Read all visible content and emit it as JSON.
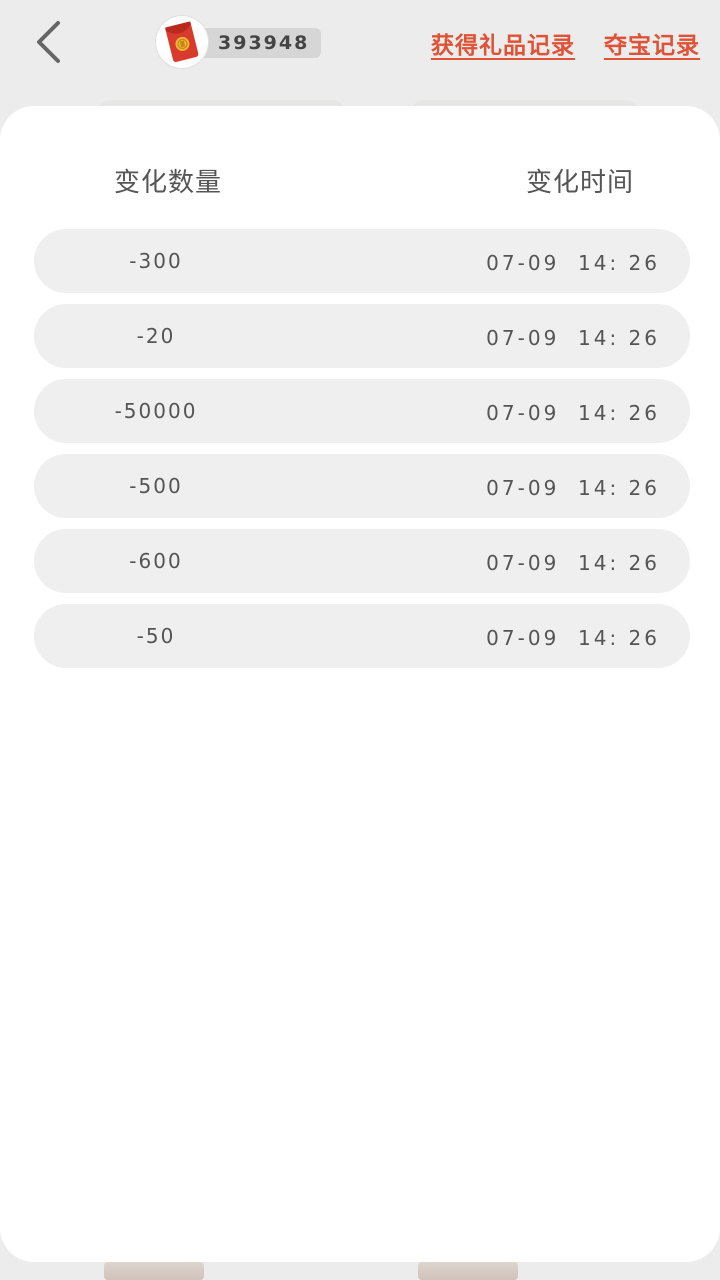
{
  "header": {
    "coin_balance": "393948",
    "link_gift_records": "获得礼品记录",
    "link_treasure_records": "夺宝记录"
  },
  "table": {
    "col_amount": "变化数量",
    "col_time": "变化时间",
    "rows": [
      {
        "amount": "-300",
        "time": "07-09  14: 26"
      },
      {
        "amount": "-20",
        "time": "07-09  14: 26"
      },
      {
        "amount": "-50000",
        "time": "07-09  14: 26"
      },
      {
        "amount": "-500",
        "time": "07-09  14: 26"
      },
      {
        "amount": "-600",
        "time": "07-09  14: 26"
      },
      {
        "amount": "-50",
        "time": "07-09  14: 26"
      }
    ]
  },
  "icons": {
    "back": "chevron-left-icon",
    "coin": "red-packet-icon"
  },
  "colors": {
    "accent_link": "#e05235",
    "row_background": "#efefef",
    "page_background": "#ececec"
  }
}
